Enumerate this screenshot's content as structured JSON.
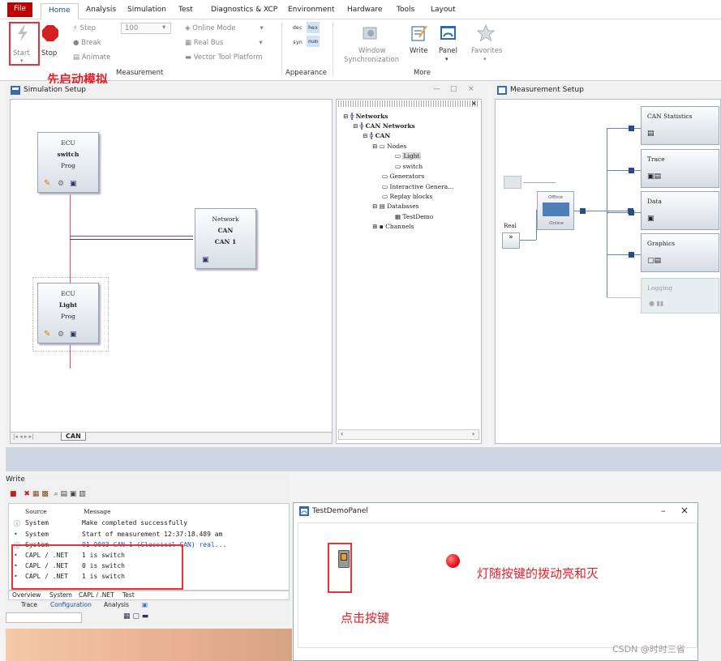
{
  "menu": {
    "file": "File",
    "home": "Home",
    "analysis": "Analysis",
    "simulation": "Simulation",
    "test": "Test",
    "diagnostics": "Diagnostics & XCP",
    "environment": "Environment",
    "hardware": "Hardware",
    "tools": "Tools",
    "layout": "Layout"
  },
  "ribbon": {
    "start": "Start",
    "stop": "Stop",
    "step": "Step",
    "brk": "Break",
    "animate": "Animate",
    "speed": "100",
    "online_mode": "Online Mode",
    "real_bus": "Real Bus",
    "vector_tool": "Vector Tool Platform",
    "measurement_group": "Measurement",
    "dec": "dec",
    "hex": "hex",
    "sym": "syn",
    "num": "num",
    "appearance": "Appearance",
    "window_sync_1": "Window",
    "window_sync_2": "Synchronization",
    "write": "Write",
    "panel": "Panel",
    "favorites": "Favorites",
    "more": "More"
  },
  "annotations": {
    "start_first": "先启动模拟",
    "light_follows": "灯随按键的拨动亮和灭",
    "click_button": "点击按键"
  },
  "sim": {
    "title": "Simulation Setup",
    "ecu1": {
      "l1": "ECU",
      "l2": "switch",
      "l3": "Prog"
    },
    "network": {
      "l1": "Network",
      "l2": "CAN",
      "l3": "CAN 1"
    },
    "ecu2": {
      "l1": "ECU",
      "l2": "Light",
      "l3": "Prog"
    },
    "tab": "CAN"
  },
  "tree": {
    "networks": "Networks",
    "can_networks": "CAN Networks",
    "can": "CAN",
    "nodes": "Nodes",
    "light": "Light",
    "switch": "switch",
    "generators": "Generators",
    "interactive": "Interactive Genera...",
    "replay": "Replay blocks",
    "databases": "Databases",
    "testdemo": "TestDemo",
    "channels": "Channels"
  },
  "meas": {
    "title": "Measurement Setup",
    "can_stats": "CAN Statistics",
    "trace": "Trace",
    "data": "Data",
    "graphics": "Graphics",
    "logging": "Logging",
    "offline": "Offline",
    "online": "Online",
    "real": "Real"
  },
  "write": {
    "title": "Write",
    "col_source": "Source",
    "col_message": "Message",
    "rows": [
      {
        "source": "System",
        "message": "Make completed successfully",
        "link": false
      },
      {
        "source": "System",
        "message": "Start of measurement 12:37:18.489 am",
        "link": false
      },
      {
        "source": "System",
        "message": "01-0003 CAN 1 (Classical CAN)  real...",
        "link": true
      },
      {
        "source": "CAPL / .NET",
        "message": "1 is switch",
        "link": false
      },
      {
        "source": "CAPL / .NET",
        "message": "0 is switch",
        "link": false
      },
      {
        "source": "CAPL / .NET",
        "message": "1 is switch",
        "link": false
      }
    ],
    "tabs": [
      "Overview",
      "System",
      "CAPL / .NET",
      "Test"
    ]
  },
  "bottom_tabs": [
    "Trace",
    "Configuration",
    "Analysis"
  ],
  "testpanel": {
    "title": "TestDemoPanel",
    "minimize": "–",
    "close": "×"
  },
  "watermark": "CSDN @时时三省",
  "colors": {
    "file_bg": "#c00000",
    "accent": "#1a50a0",
    "annotation": "#e0202a",
    "lamp": "#e8101c"
  }
}
